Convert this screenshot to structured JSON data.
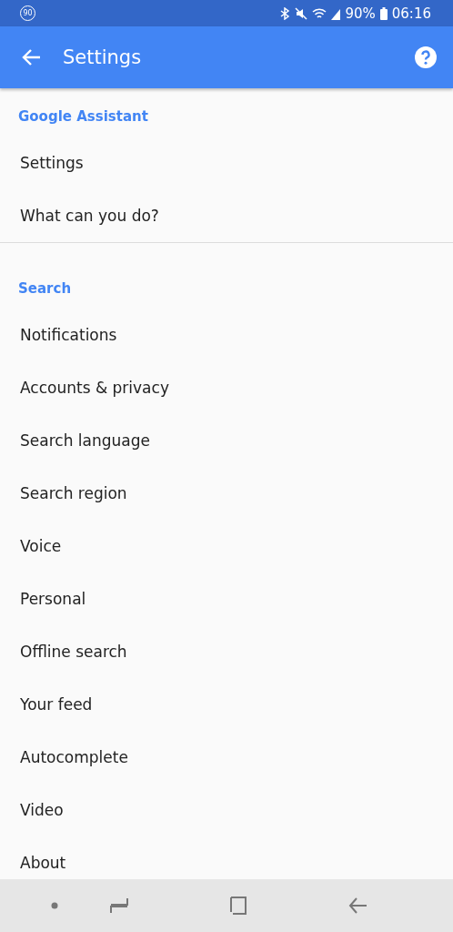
{
  "status_bar": {
    "left_badge": "90",
    "battery": "90%",
    "time": "06:16"
  },
  "app_bar": {
    "title": "Settings"
  },
  "sections": [
    {
      "title": "Google Assistant",
      "items": [
        "Settings",
        "What can you do?"
      ]
    },
    {
      "title": "Search",
      "items": [
        "Notifications",
        "Accounts & privacy",
        "Search language",
        "Search region",
        "Voice",
        "Personal",
        "Offline search",
        "Your feed",
        "Autocomplete",
        "Video",
        "About"
      ]
    }
  ]
}
